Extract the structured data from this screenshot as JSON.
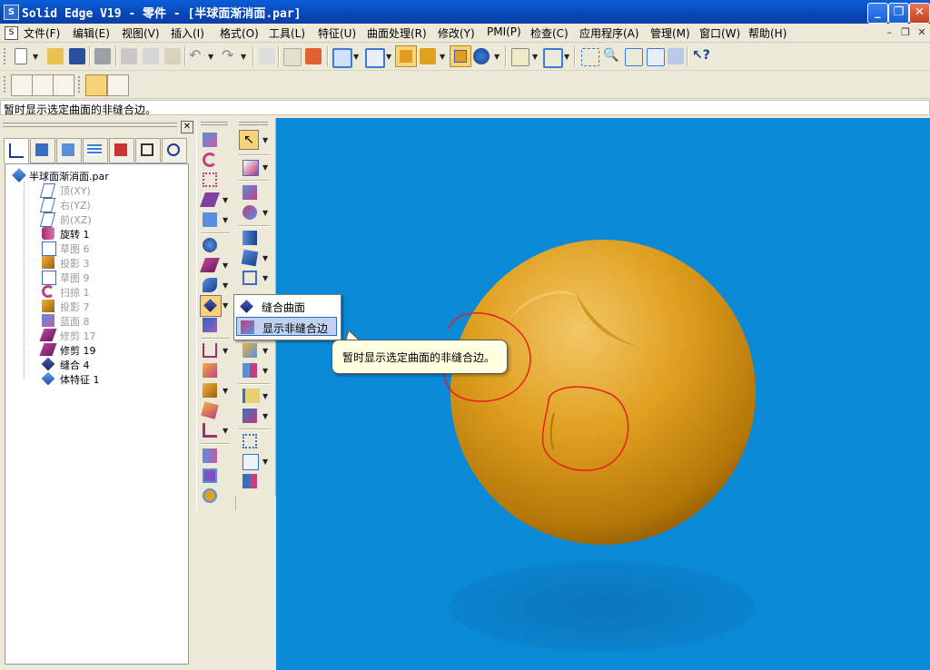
{
  "window": {
    "title": "Solid Edge V19 - 零件 - [半球面渐消面.par]",
    "minimize": "_",
    "maximize": "❐",
    "close": "✕"
  },
  "menu": {
    "items": [
      "文件(F)",
      "编辑(E)",
      "视图(V)",
      "插入(I)",
      "格式(O)",
      "工具(L)",
      "特征(U)",
      "曲面处理(R)",
      "修改(Y)",
      "PMI(P)",
      "检查(C)",
      "应用程序(A)",
      "管理(M)",
      "窗口(W)",
      "帮助(H)"
    ],
    "mdi_minimize": "–",
    "mdi_restore": "❐",
    "mdi_close": "✕"
  },
  "prompt": {
    "text": "暂时显示选定曲面的非缝合边。"
  },
  "panel": {
    "close": "✕",
    "tree": [
      {
        "label": "半球面渐消面.par",
        "icon": "part-file-icon",
        "muted": false
      },
      {
        "label": "顶(XY)",
        "icon": "plane-icon",
        "muted": true
      },
      {
        "label": "右(YZ)",
        "icon": "plane-icon",
        "muted": true
      },
      {
        "label": "前(XZ)",
        "icon": "plane-icon",
        "muted": true
      },
      {
        "label": "旋转 1",
        "icon": "revolve-icon",
        "muted": false
      },
      {
        "label": "草图 6",
        "icon": "sketch-icon",
        "muted": true
      },
      {
        "label": "投影 3",
        "icon": "projection-icon",
        "muted": true
      },
      {
        "label": "草图 9",
        "icon": "sketch-icon",
        "muted": true
      },
      {
        "label": "扫掠 1",
        "icon": "sweep-icon",
        "muted": true
      },
      {
        "label": "投影 7",
        "icon": "projection-icon",
        "muted": true
      },
      {
        "label": "蓝面 8",
        "icon": "bluesurf-icon",
        "muted": true
      },
      {
        "label": "修剪 17",
        "icon": "trim-icon",
        "muted": true
      },
      {
        "label": "修剪 19",
        "icon": "trim-icon",
        "muted": false
      },
      {
        "label": "缝合 4",
        "icon": "stitch-icon",
        "muted": false
      },
      {
        "label": "体特征 1",
        "icon": "body-feature-icon",
        "muted": false
      }
    ]
  },
  "popup": {
    "items": [
      {
        "label": "缝合曲面",
        "icon": "stitch-surface-icon",
        "highlighted": false
      },
      {
        "label": "显示非缝合边",
        "icon": "show-nonstitched-edges-icon",
        "highlighted": true
      }
    ]
  },
  "tooltip": {
    "text": "暂时显示选定曲面的非缝合边。"
  },
  "colors": {
    "viewport_bg": "#0a8ad6",
    "sphere": "#e0a020",
    "annotation": "#e81e1e",
    "titlebar": "#0a5fd8"
  }
}
